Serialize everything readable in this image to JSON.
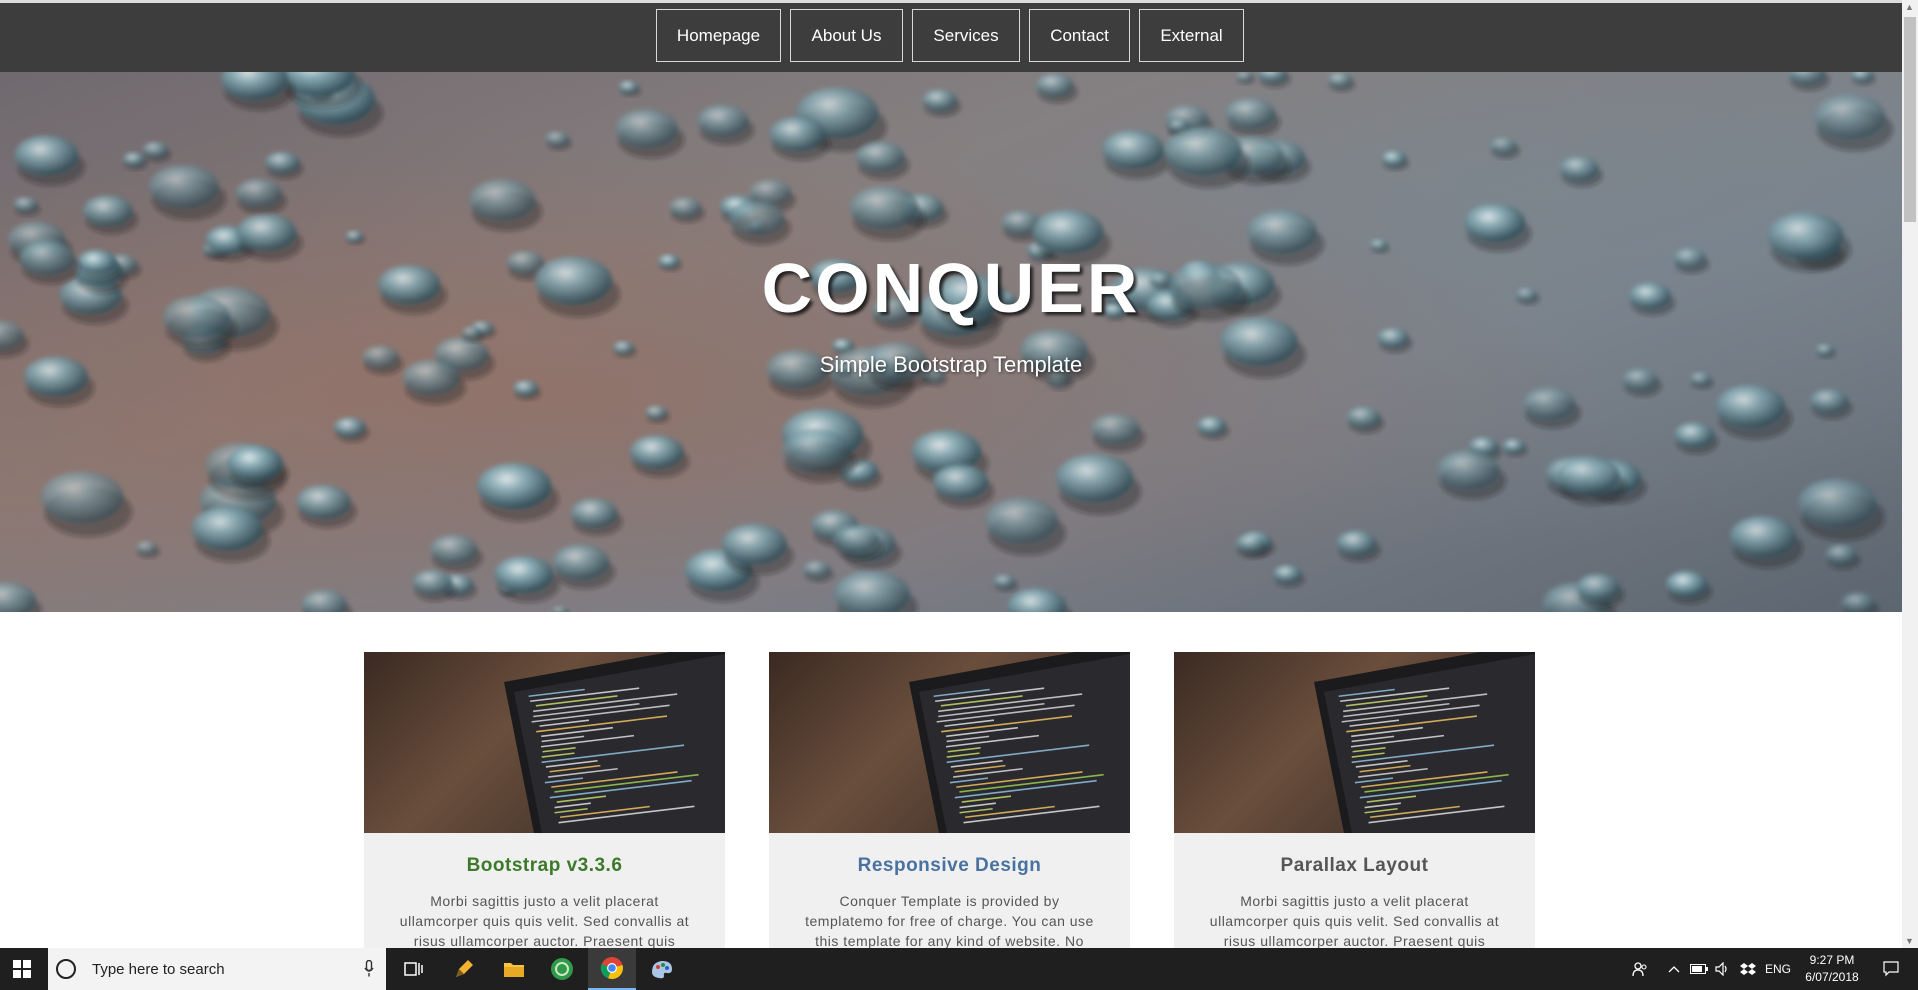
{
  "nav": {
    "items": [
      {
        "label": "Homepage"
      },
      {
        "label": "About Us"
      },
      {
        "label": "Services"
      },
      {
        "label": "Contact"
      },
      {
        "label": "External"
      }
    ]
  },
  "hero": {
    "title": "CONQUER",
    "subtitle": "Simple Bootstrap Template"
  },
  "cards": [
    {
      "title": "Bootstrap v3.3.6",
      "title_color": "#3c7a2a",
      "text": "Morbi sagittis justo a velit placerat ullamcorper quis quis velit. Sed convallis at risus ullamcorper auctor. Praesent quis"
    },
    {
      "title": "Responsive Design",
      "title_color": "#4a72a0",
      "text": "Conquer Template is provided by templatemo for free of charge. You can use this template for any kind of website. No"
    },
    {
      "title": "Parallax Layout",
      "title_color": "#555555",
      "text": "Morbi sagittis justo a velit placerat ullamcorper quis quis velit. Sed convallis at risus ullamcorper auctor. Praesent quis"
    }
  ],
  "taskbar": {
    "search_placeholder": "Type here to search",
    "language": "ENG",
    "time": "9:27 PM",
    "date": "6/07/2018",
    "apps": [
      "task-view-icon",
      "pen-app-icon",
      "file-explorer-icon",
      "green-app-icon",
      "chrome-icon",
      "paint-icon"
    ]
  }
}
